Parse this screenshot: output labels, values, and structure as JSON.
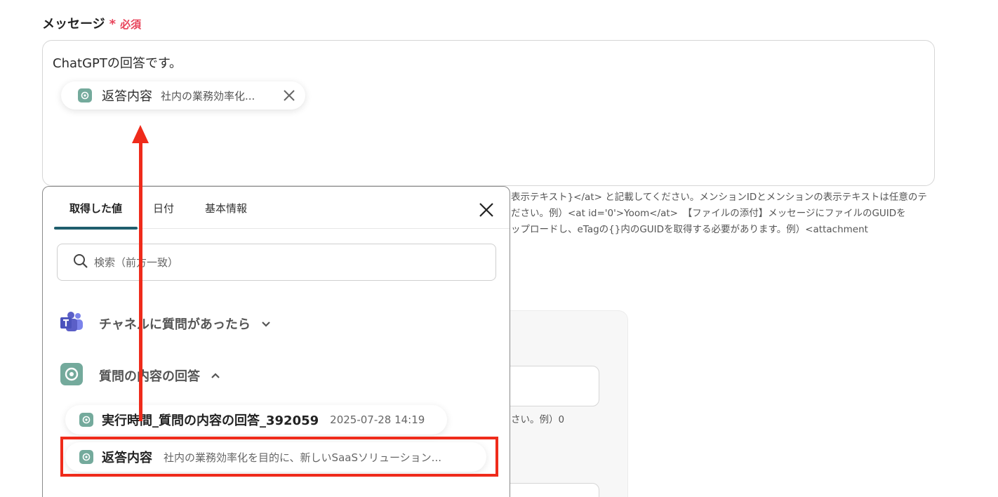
{
  "field": {
    "label": "メッセージ",
    "required_star": "*",
    "required_text": "必須"
  },
  "message": {
    "text": "ChatGPTの回答です。",
    "chip_title": "返答内容",
    "chip_sub": "社内の業務効率化..."
  },
  "help": {
    "lines": [
      "表示テキスト}</at> と記載してください。メンションIDとメンションの表示テキストは任意のテ",
      "ださい。例）<at id='0'>Yoom</at>　【ファイルの添付】メッセージにファイルのGUIDを",
      "ップロードし、eTagの{}内のGUIDを取得する必要があります。例）<attachment"
    ],
    "behind_text": "さい。例）0"
  },
  "popup": {
    "tabs": [
      "取得した値",
      "日付",
      "基本情報"
    ],
    "search_placeholder": "検索（前方一致）",
    "groups": [
      {
        "title": "チャネルに質問があったら",
        "icon": "teams-icon"
      },
      {
        "title": "質問の内容の回答",
        "icon": "chatgpt-icon"
      }
    ],
    "items": [
      {
        "title": "実行時間_質問の内容の回答_392059",
        "sub": "2025-07-28 14:19"
      },
      {
        "title": "返答内容",
        "sub": "社内の業務効率化を目的に、新しいSaaSソリューション..."
      }
    ]
  },
  "colors": {
    "required": "#e8435a",
    "tab_indicator": "#1f5e6d",
    "chatgpt": "#74aa9c",
    "teams": "#5b5fc7",
    "annotation": "#ef2b1b"
  }
}
